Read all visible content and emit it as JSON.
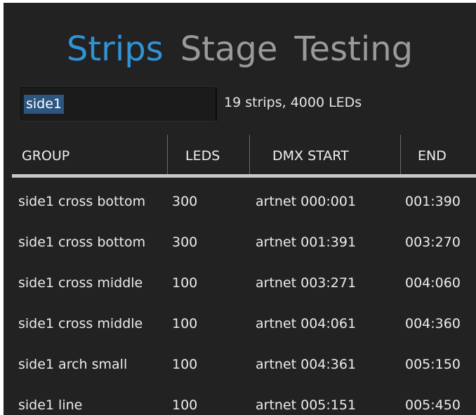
{
  "tabs": [
    {
      "label": "Strips",
      "active": true
    },
    {
      "label": "Stage",
      "active": false
    },
    {
      "label": "Testing",
      "active": false
    }
  ],
  "filter": {
    "value": "side1",
    "summary": "19 strips, 4000 LEDs"
  },
  "table": {
    "columns": [
      "GROUP",
      "LEDS",
      "DMX START",
      "END"
    ],
    "rows": [
      [
        "side1 cross bottom",
        "300",
        "artnet 000:001",
        "001:390"
      ],
      [
        "side1 cross bottom",
        "300",
        "artnet 001:391",
        "003:270"
      ],
      [
        "side1 cross middle",
        "100",
        "artnet 003:271",
        "004:060"
      ],
      [
        "side1 cross middle",
        "100",
        "artnet 004:061",
        "004:360"
      ],
      [
        "side1 arch small",
        "100",
        "artnet 004:361",
        "005:150"
      ],
      [
        "side1 line",
        "100",
        "artnet 005:151",
        "005:450"
      ]
    ]
  },
  "colors": {
    "background": "#222222",
    "accent": "#2f93d6",
    "inactive_tab": "#9a9a9a",
    "selection": "#2c5680"
  }
}
